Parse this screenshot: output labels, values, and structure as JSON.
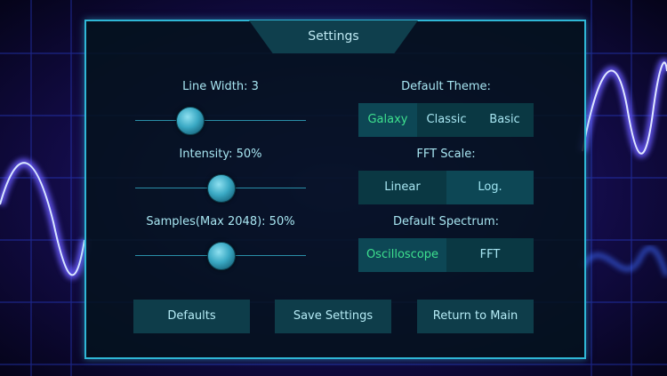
{
  "title": "Settings",
  "sliders": [
    {
      "label": "Line Width: 3",
      "value": 0.32
    },
    {
      "label": "Intensity: 50%",
      "value": 0.5
    },
    {
      "label": "Samples(Max 2048): 50%",
      "value": 0.5
    }
  ],
  "theme": {
    "label": "Default Theme:",
    "options": [
      "Galaxy",
      "Classic",
      "Basic"
    ],
    "selected": "Galaxy"
  },
  "fft_scale": {
    "label": "FFT Scale:",
    "options": [
      "Linear",
      "Log."
    ],
    "selected": "Log."
  },
  "spectrum": {
    "label": "Default Spectrum:",
    "options": [
      "Oscilloscope",
      "FFT"
    ],
    "selected": "Oscilloscope"
  },
  "buttons": {
    "defaults": "Defaults",
    "save": "Save Settings",
    "return": "Return to Main"
  },
  "colors": {
    "accent": "#2fb7d6",
    "selected_text": "#3ee08e",
    "text": "#a8e6f2",
    "background_wave": "#5a3cff"
  }
}
